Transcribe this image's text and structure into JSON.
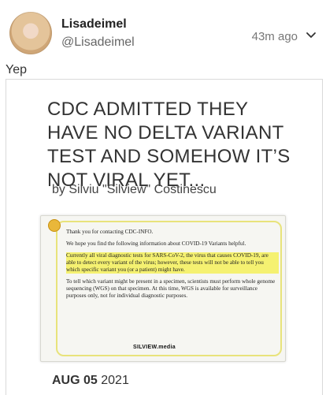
{
  "author": {
    "name": "Lisadeimel",
    "handle": "@Lisadeimel"
  },
  "post": {
    "time": "43m ago",
    "text": "Yep"
  },
  "card": {
    "headline": "CDC ADMITTED THEY HAVE NO DELTA VARIANT TEST AND SOMEHOW IT’S NOT VIRAL YET...",
    "byline": "by Silviu \"Silview\" Costinescu",
    "image": {
      "line1": "Thank you for contacting CDC-INFO.",
      "line2": "We hope you find the following information about COVID-19 Variants helpful.",
      "line3": "Currently all viral diagnostic tests for SARS-CoV-2, the virus that causes COVID-19, are able to detect every variant of the virus; however, these tests will not be able to tell you which specific variant you (or a patient) might have.",
      "line4": "To tell which variant might be present in a specimen, scientists must perform whole genome sequencing (WGS) on that specimen. At this time, WGS is available for surveillance purposes only, not for individual diagnostic purposes.",
      "watermark": "SILVIEW.media"
    },
    "date_month_day": "AUG 05",
    "date_year": "2021"
  },
  "icons": {
    "menu": "chevron-down-icon",
    "badge": "face-badge-icon"
  }
}
